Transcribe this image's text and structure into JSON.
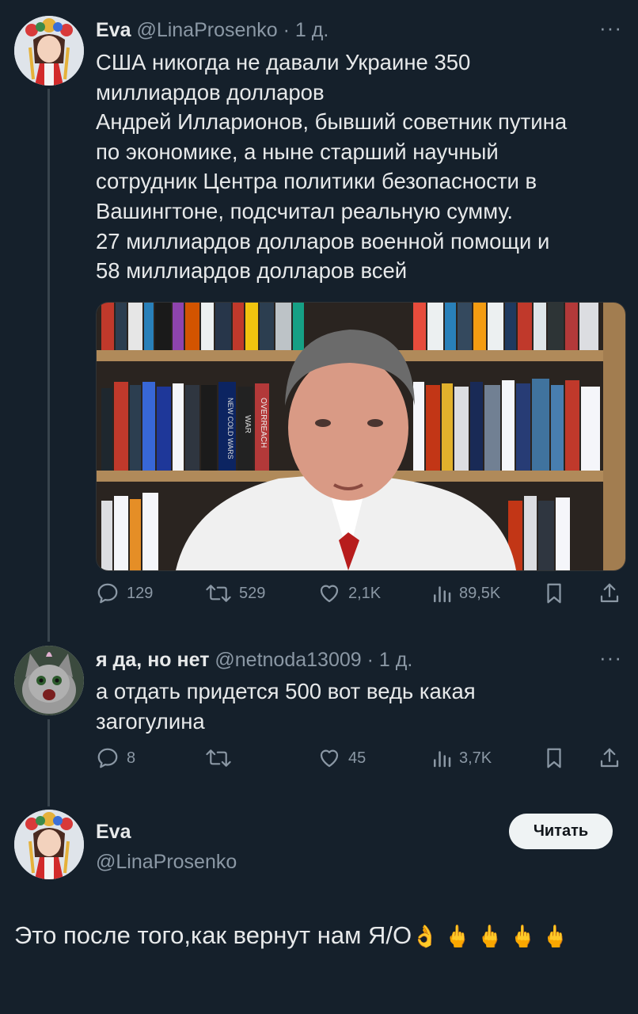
{
  "tweet": {
    "name": "Eva",
    "handle": "@LinaProsenko",
    "time": "· 1 д.",
    "lines": [
      "США никогда не давали Украине 350",
      "миллиардов долларов",
      "Андрей Илларионов, бывший советник путина",
      "по экономике, а ныне старший научный",
      "сотрудник Центра политики безопасности в",
      "Вашингтоне, подсчитал реальную сумму.",
      "27 миллиардов долларов военной помощи и",
      "58 миллиардов долларов всей"
    ],
    "stats": {
      "replies": "129",
      "retweets": "529",
      "likes": "2,1K",
      "views": "89,5K"
    },
    "book_spines": [
      "WAR",
      "NEW COLD WARS",
      "OVERREACH"
    ]
  },
  "reply": {
    "name": "я да, но нет",
    "handle": "@netnoda13009",
    "time": "· 1 д.",
    "lines": [
      "а отдать придется 500 вот ведь какая",
      "загогулина"
    ],
    "stats": {
      "replies": "8",
      "retweets": "",
      "likes": "45",
      "views": "3,7K"
    }
  },
  "profile": {
    "name": "Eva",
    "handle": "@LinaProsenko",
    "follow_label": "Читать"
  },
  "composed_reply": {
    "text": "Это после того,как вернут нам Я/О",
    "emojis": "👌 🖕 🖕 🖕 🖕"
  },
  "more_label": "···",
  "colors": {
    "background": "#15202b",
    "text": "#e7e9ea",
    "muted": "#8b98a5",
    "button": "#eff3f4"
  }
}
